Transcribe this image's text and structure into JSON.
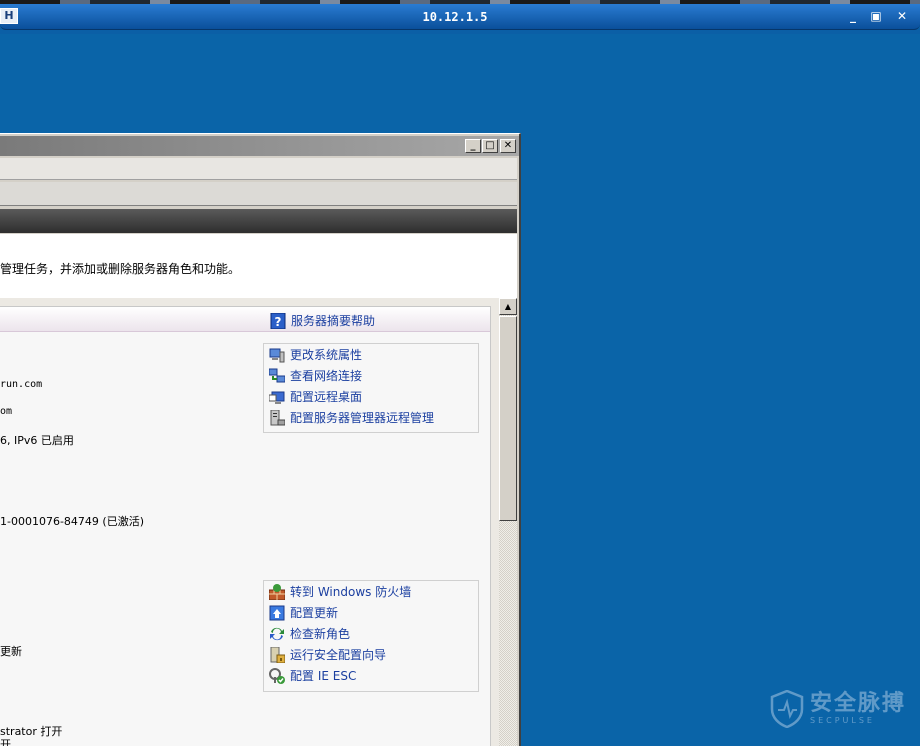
{
  "remote_session": {
    "title": "10.12.1.5",
    "pin_label": "H",
    "controls": {
      "minimize": "_",
      "restore": "▣",
      "close": "✕"
    }
  },
  "window": {
    "caption_buttons": {
      "minimize": "_",
      "maximize": "□",
      "close": "✕"
    },
    "description": "管理任务，并添加或删除服务器角色和功能。"
  },
  "summary_panel": {
    "help_link": "服务器摘要帮助",
    "computer_info_actions": [
      {
        "label": "更改系统属性",
        "icon": "system-properties-icon"
      },
      {
        "label": "查看网络连接",
        "icon": "network-connections-icon"
      },
      {
        "label": "配置远程桌面",
        "icon": "remote-desktop-icon"
      },
      {
        "label": "配置服务器管理器远程管理",
        "icon": "server-manager-icon"
      }
    ],
    "security_actions": [
      {
        "label": "转到 Windows 防火墙",
        "icon": "firewall-icon"
      },
      {
        "label": "配置更新",
        "icon": "update-icon"
      },
      {
        "label": "检查新角色",
        "icon": "check-roles-icon"
      },
      {
        "label": "运行安全配置向导",
        "icon": "security-wizard-icon"
      },
      {
        "label": "配置 IE ESC",
        "icon": "ie-esc-icon"
      }
    ],
    "properties": [
      "run.com",
      "om",
      "6, IPv6 已启用",
      "1-0001076-84749 (已激活)",
      "更新",
      "strator 打开",
      "开"
    ]
  },
  "watermark": {
    "main": "安全脉搏",
    "sub": "SECPULSE"
  }
}
